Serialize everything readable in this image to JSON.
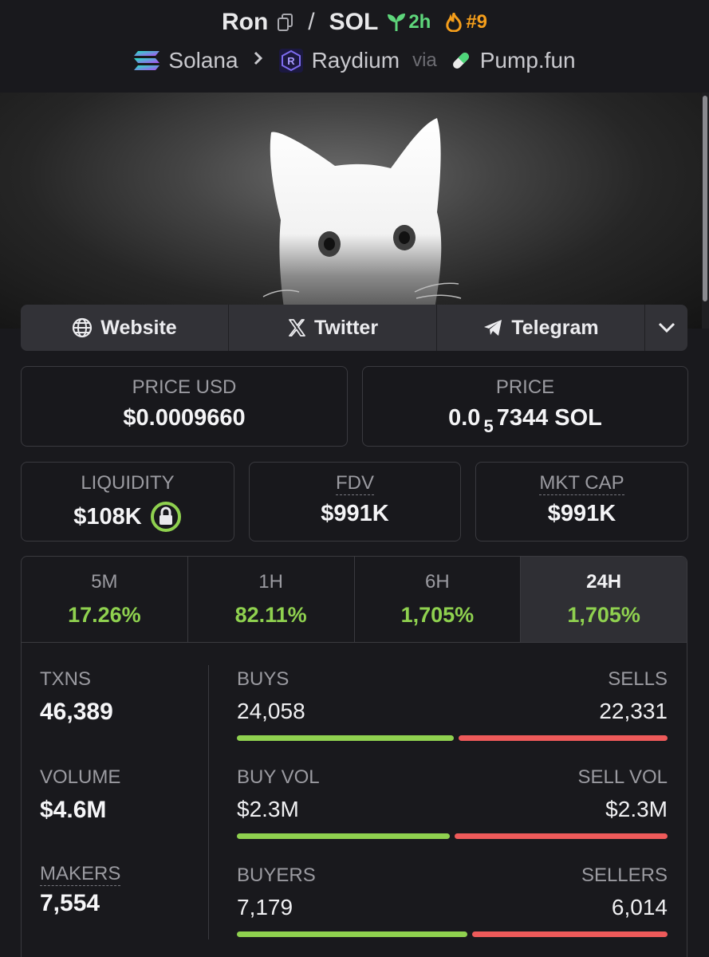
{
  "header": {
    "token": "Ron",
    "quote": "SOL",
    "slash": "/",
    "age": "2h",
    "rank": "#9",
    "chain": "Solana",
    "dex": "Raydium",
    "via": "via",
    "launchpad": "Pump.fun"
  },
  "links": {
    "website": "Website",
    "twitter": "Twitter",
    "telegram": "Telegram"
  },
  "price": {
    "usd_label": "PRICE USD",
    "usd_value": "$0.0009660",
    "native_label": "PRICE",
    "native_prefix": "0.0",
    "native_zeros": "5",
    "native_rest": "7344 SOL"
  },
  "metrics": {
    "liquidity_label": "LIQUIDITY",
    "liquidity_value": "$108K",
    "fdv_label": "FDV",
    "fdv_value": "$991K",
    "mcap_label": "MKT CAP",
    "mcap_value": "$991K"
  },
  "timeframes": [
    {
      "period": "5M",
      "change": "17.26%"
    },
    {
      "period": "1H",
      "change": "82.11%"
    },
    {
      "period": "6H",
      "change": "1,705%"
    },
    {
      "period": "24H",
      "change": "1,705%"
    }
  ],
  "stats": {
    "txns_label": "TXNS",
    "txns_value": "46,389",
    "volume_label": "VOLUME",
    "volume_value": "$4.6M",
    "makers_label": "MAKERS",
    "makers_value": "7,554",
    "buys_label": "BUYS",
    "buys_value": "24,058",
    "sells_label": "SELLS",
    "sells_value": "22,331",
    "buy_vol_label": "BUY VOL",
    "buy_vol_value": "$2.3M",
    "sell_vol_label": "SELL VOL",
    "sell_vol_value": "$2.3M",
    "buyers_label": "BUYERS",
    "buyers_value": "7,179",
    "sellers_label": "SELLERS",
    "sellers_value": "6,014",
    "buys_share": 0.51,
    "buy_vol_share": 0.5,
    "buyers_share": 0.54
  },
  "colors": {
    "positive": "#8fd14f",
    "negative": "#ee5a5a",
    "age": "#5ed67b",
    "rank": "#f59e1b"
  },
  "icons": [
    "copy-icon",
    "seedling-icon",
    "flame-icon",
    "solana-icon",
    "chevron-right-icon",
    "raydium-icon",
    "pill-icon",
    "globe-icon",
    "x-icon",
    "telegram-icon",
    "chevron-down-icon",
    "lock-icon"
  ]
}
